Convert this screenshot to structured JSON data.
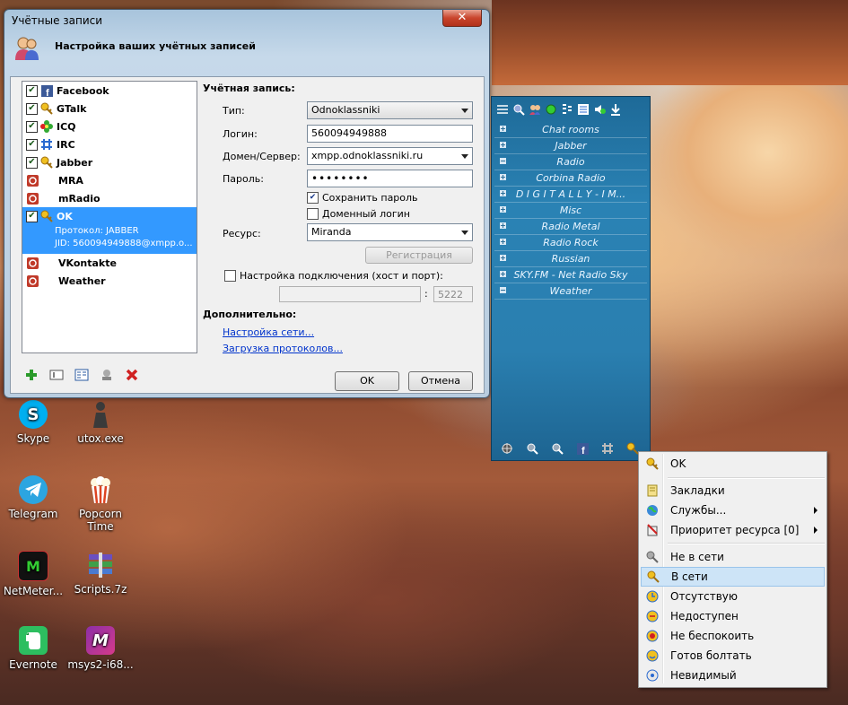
{
  "window": {
    "title": "Учётные записи",
    "close_glyph": "✕",
    "header": "Настройка ваших учётных записей"
  },
  "accounts": [
    {
      "name": "Facebook",
      "checked": true,
      "icon": "facebook-icon"
    },
    {
      "name": "GTalk",
      "checked": true,
      "icon": "key-icon"
    },
    {
      "name": "ICQ",
      "checked": true,
      "icon": "icq-flower-icon"
    },
    {
      "name": "IRC",
      "checked": true,
      "icon": "irc-icon"
    },
    {
      "name": "Jabber",
      "checked": true,
      "icon": "key-icon"
    },
    {
      "name": "MRA",
      "checked": false,
      "icon": "disabled-icon"
    },
    {
      "name": "mRadio",
      "checked": false,
      "icon": "disabled-icon"
    },
    {
      "name": "OK",
      "checked": true,
      "icon": "key-icon",
      "selected": true,
      "protocol": "Протокол: JABBER",
      "jid": "JID: 560094949888@xmpp.o..."
    },
    {
      "name": "VKontakte",
      "checked": false,
      "icon": "disabled-icon"
    },
    {
      "name": "Weather",
      "checked": false,
      "icon": "disabled-icon"
    }
  ],
  "account_form": {
    "section_title": "Учётная запись:",
    "type_label": "Тип:",
    "type_value": "Odnoklassniki",
    "login_label": "Логин:",
    "login_value": "560094949888",
    "domain_label": "Домен/Сервер:",
    "domain_value": "xmpp.odnoklassniki.ru",
    "password_label": "Пароль:",
    "password_value": "••••••••",
    "save_password": "Сохранить пароль",
    "save_password_checked": true,
    "domain_login": "Доменный логин",
    "domain_login_checked": false,
    "resource_label": "Ресурс:",
    "resource_value": "Miranda",
    "register_button": "Регистрация",
    "connection_settings": "Настройка подключения (хост и порт):",
    "connection_host": "",
    "port_separator": ":",
    "connection_port": "5222",
    "extra_title": "Дополнительно:",
    "network_link": "Настройка сети...",
    "protocols_link": "Загрузка протоколов...",
    "ok_button": "OK",
    "cancel_button": "Отмена"
  },
  "contact_list": {
    "groups": [
      {
        "name": "Chat rooms",
        "expanded": false
      },
      {
        "name": "Jabber",
        "expanded": false
      },
      {
        "name": "Radio",
        "expanded": true
      },
      {
        "name": "Corbina Radio",
        "expanded": false
      },
      {
        "name": "D I G I T A L L Y - I M...",
        "expanded": false
      },
      {
        "name": "Misc",
        "expanded": false
      },
      {
        "name": "Radio Metal",
        "expanded": false
      },
      {
        "name": "Radio Rock",
        "expanded": false
      },
      {
        "name": "Russian",
        "expanded": false
      },
      {
        "name": "SKY.FM - Net Radio Sky",
        "expanded": false
      },
      {
        "name": "Weather",
        "expanded": true
      }
    ]
  },
  "context_menu": {
    "items": [
      {
        "label": "OK",
        "icon": "key-icon"
      },
      {
        "label": "Закладки",
        "icon": "bookmark-icon"
      },
      {
        "label": "Службы...",
        "icon": "globe-icon",
        "submenu": true
      },
      {
        "label": "Приоритет ресурса [0]",
        "icon": "priority-icon",
        "submenu": true
      },
      {
        "label": "Не в сети",
        "icon": "offline-icon"
      },
      {
        "label": "В сети",
        "icon": "online-icon"
      },
      {
        "label": "Отсутствую",
        "icon": "away-icon"
      },
      {
        "label": "Недоступен",
        "icon": "na-icon"
      },
      {
        "label": "Не беспокоить",
        "icon": "dnd-icon"
      },
      {
        "label": "Готов болтать",
        "icon": "chat-icon"
      },
      {
        "label": "Невидимый",
        "icon": "invisible-icon"
      }
    ]
  },
  "desktop_icons": [
    {
      "label": "Skype",
      "color": "#00aff0"
    },
    {
      "label": "utox.exe",
      "color": "#444444"
    },
    {
      "label": "Telegram",
      "color": "#2ca5e0"
    },
    {
      "label": "Popcorn Time",
      "color": "#ffffff"
    },
    {
      "label": "NetMeter...",
      "color": "#1a1a1a"
    },
    {
      "label": "Scripts.7z",
      "color": "#5a3fa0"
    },
    {
      "label": "Evernote",
      "color": "#2dbe60"
    },
    {
      "label": "msys2-i68...",
      "color": "#8b2fa8"
    }
  ]
}
